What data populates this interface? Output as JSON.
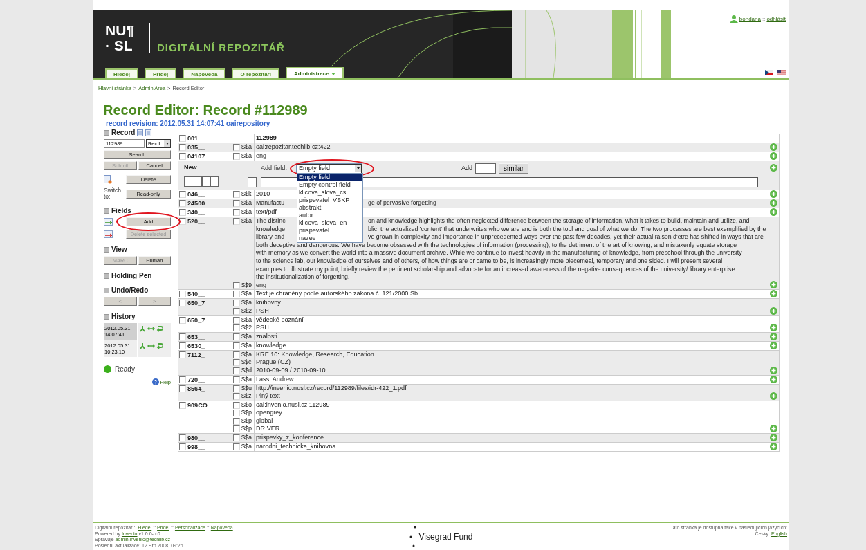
{
  "header": {
    "logo_lines": [
      "NU¶",
      "· SL"
    ],
    "site_name": "DIGITÁLNÍ REPOZITÁŘ",
    "tabs": [
      {
        "label": "Hledej",
        "selected": false,
        "caret": false
      },
      {
        "label": "Přidej",
        "selected": false,
        "caret": false
      },
      {
        "label": "Nápověda",
        "selected": false,
        "caret": false
      },
      {
        "label": "O repozitáři",
        "selected": false,
        "caret": false
      },
      {
        "label": "Administrace",
        "selected": true,
        "caret": true
      }
    ],
    "user": {
      "name": "bohdana",
      "separator": "::",
      "logout": "odhlásit"
    }
  },
  "breadcrumb": {
    "items": [
      "Hlavní stránka",
      "Admin Area",
      "Record Editor"
    ],
    "separator": ">"
  },
  "title": "Record Editor: Record #112989",
  "revision": "record revision: 2012.05.31 14:07:41 oairepository",
  "sidebar": {
    "record": {
      "title": "Record",
      "record_id": "112989",
      "type_select": "Rec I",
      "search": {
        "label": "Search",
        "disabled": false
      },
      "submit": {
        "label": "Submit",
        "disabled": true
      },
      "cancel": {
        "label": "Cancel",
        "disabled": false
      },
      "delete": {
        "label": "Delete",
        "disabled": false
      },
      "switch_label": "Switch to:",
      "read_only": {
        "label": "Read-only",
        "disabled": false
      }
    },
    "fields": {
      "title": "Fields",
      "add": {
        "label": "Add",
        "disabled": false
      },
      "delete_selected": {
        "label": "Delete selected",
        "disabled": true
      }
    },
    "view": {
      "title": "View",
      "buttons": [
        {
          "label": "MARC",
          "disabled": true
        },
        {
          "label": "Human",
          "disabled": false
        }
      ]
    },
    "holding_pen": {
      "title": "Holding Pen"
    },
    "undo_redo": {
      "title": "Undo/Redo",
      "buttons": [
        {
          "label": "<",
          "disabled": true
        },
        {
          "label": ">",
          "disabled": true
        }
      ]
    },
    "history": {
      "title": "History",
      "entries": [
        {
          "date": "2012.05.31",
          "time": "14:07:41",
          "selected": true
        },
        {
          "date": "2012.05.31",
          "time": "10:23:10",
          "selected": false
        }
      ]
    },
    "status": "Ready",
    "help": "Help"
  },
  "fields": [
    {
      "kind": "control",
      "tag": "001",
      "checked": false,
      "value": "112989"
    },
    {
      "kind": "data",
      "tag": "035__",
      "checked": false,
      "subfields": [
        {
          "code": "$$a",
          "checked": false,
          "value": "oai:repozitar.techlib.cz:422"
        }
      ]
    },
    {
      "kind": "data",
      "tag": "04107",
      "checked": false,
      "subfields": [
        {
          "code": "$$a",
          "checked": false,
          "value": "eng"
        }
      ]
    },
    {
      "kind": "new",
      "label": "New",
      "add_field_label": "Add field:",
      "select": {
        "value": "Empty field",
        "expanded": true,
        "options": [
          {
            "label": "Empty field",
            "selected": true
          },
          {
            "label": "Empty control field",
            "selected": false
          },
          {
            "label": "klicova_slova_cs",
            "selected": false
          },
          {
            "label": "prispevatel_VSKP",
            "selected": false
          },
          {
            "label": "abstrakt",
            "selected": false
          },
          {
            "label": "autor",
            "selected": false
          },
          {
            "label": "klicova_slova_en",
            "selected": false
          },
          {
            "label": "prispevatel",
            "selected": false
          },
          {
            "label": "nazev",
            "selected": false
          }
        ]
      },
      "add_label": "Add",
      "similar": "similar"
    },
    {
      "kind": "data",
      "tag": "046__",
      "checked": false,
      "subfields": [
        {
          "code": "$$k",
          "checked": false,
          "value": "2010"
        }
      ]
    },
    {
      "kind": "data",
      "tag": "24500",
      "checked": false,
      "subfields": [
        {
          "code": "$$a",
          "checked": false,
          "lines": [
            {
              "left": "Manufactu",
              "right": "ge of pervasive forgetting"
            }
          ]
        }
      ]
    },
    {
      "kind": "data",
      "tag": "340__",
      "checked": false,
      "subfields": [
        {
          "code": "$$a",
          "checked": false,
          "value": "text/pdf"
        }
      ]
    },
    {
      "kind": "data",
      "tag": "520__",
      "checked": false,
      "subfields": [
        {
          "code": "$$a",
          "checked": false,
          "lines": [
            {
              "left": "The distinc",
              "right": "on and knowledge highlights the often neglected difference between the storage of information, what it takes to build, maintain and utilize, and"
            },
            {
              "left": "knowledge",
              "right": "blic, the actualized 'content' that underwrites who we are and is both the tool and goal of what we do. The two processes are best exemplified by the"
            },
            {
              "left": "library and",
              "right": "ve grown in complexity and importance in unprecedented ways over the past few decades, yet their actual raison d'etre has shifted in ways that are"
            },
            {
              "left": "both deceptive and dangerous. We have become obsessed with the technologies of information (processing), to the detriment of the art of knowing, and mistakenly equate storage"
            },
            {
              "left": "with memory as we convert the world into a massive document archive. While we continue to invest heavily in the manufacturing of knowledge, from preschool through the university"
            },
            {
              "left": "to the science lab, our knowledge of ourselves and of others, of how things are or came to be, is increasingly more piecemeal, temporary and one sided. I will present several"
            },
            {
              "left": "examples to illustrate my point, briefly review the pertinent scholarship and advocate for an increased awareness of the negative consequences of the university/ library enterprise:"
            },
            {
              "left": "the institutionalization of forgetting."
            }
          ]
        },
        {
          "code": "$$9",
          "checked": false,
          "value": "eng"
        }
      ]
    },
    {
      "kind": "data",
      "tag": "540__",
      "checked": false,
      "subfields": [
        {
          "code": "$$a",
          "checked": false,
          "value": "Text je chráněný podle autorského zákona č. 121/2000 Sb."
        }
      ]
    },
    {
      "kind": "data",
      "tag": "650_7",
      "checked": false,
      "subfields": [
        {
          "code": "$$a",
          "checked": false,
          "value": "knihovny"
        },
        {
          "code": "$$2",
          "checked": false,
          "value": "PSH"
        }
      ]
    },
    {
      "kind": "data",
      "tag": "650_7",
      "checked": false,
      "subfields": [
        {
          "code": "$$a",
          "checked": false,
          "value": "vědecké poznání"
        },
        {
          "code": "$$2",
          "checked": false,
          "value": "PSH"
        }
      ]
    },
    {
      "kind": "data",
      "tag": "653__",
      "checked": false,
      "subfields": [
        {
          "code": "$$a",
          "checked": false,
          "value": "znalosti"
        }
      ]
    },
    {
      "kind": "data",
      "tag": "6530_",
      "checked": false,
      "subfields": [
        {
          "code": "$$a",
          "checked": false,
          "value": "knowledge"
        }
      ]
    },
    {
      "kind": "data",
      "tag": "7112_",
      "checked": false,
      "subfields": [
        {
          "code": "$$a",
          "checked": false,
          "value": "KRE 10: Knowledge, Research, Education"
        },
        {
          "code": "$$c",
          "checked": false,
          "value": "Prague (CZ)"
        },
        {
          "code": "$$d",
          "checked": false,
          "value": "2010-09-09 / 2010-09-10"
        }
      ]
    },
    {
      "kind": "data",
      "tag": "720__",
      "checked": false,
      "subfields": [
        {
          "code": "$$a",
          "checked": false,
          "value": "Lass, Andrew"
        }
      ]
    },
    {
      "kind": "data",
      "tag": "8564_",
      "checked": false,
      "subfields": [
        {
          "code": "$$u",
          "checked": false,
          "value": "http://invenio.nusl.cz/record/112989/files/idr-422_1.pdf"
        },
        {
          "code": "$$z",
          "checked": false,
          "value": "Plný text"
        }
      ]
    },
    {
      "kind": "data",
      "tag": "909CO",
      "checked": false,
      "subfields": [
        {
          "code": "$$o",
          "checked": false,
          "value": "oai:invenio.nusl.cz:112989"
        },
        {
          "code": "$$p",
          "checked": false,
          "value": "opengrey"
        },
        {
          "code": "$$p",
          "checked": false,
          "value": "global"
        },
        {
          "code": "$$p",
          "checked": false,
          "value": "DRIVER"
        }
      ]
    },
    {
      "kind": "data",
      "tag": "980__",
      "checked": false,
      "subfields": [
        {
          "code": "$$a",
          "checked": false,
          "value": "prispevky_z_konference"
        }
      ]
    },
    {
      "kind": "data",
      "tag": "998__",
      "checked": false,
      "subfields": [
        {
          "code": "$$a",
          "checked": false,
          "value": "narodni_technicka_knihovna"
        }
      ]
    }
  ],
  "footer": {
    "site": "Digitální repozitář",
    "separator": "::",
    "links": [
      "Hledej",
      "Přidej",
      "Personalizace",
      "Nápověda"
    ],
    "powered": {
      "before": "Powered by",
      "link": "Invenio",
      "after": "v1.0.0-rc0"
    },
    "maintainer": {
      "before": "Spravuje",
      "link": "admin.invenio@techlib.cz"
    },
    "updated": "Poslední aktualizace: 12 Srp 2008, 09:26",
    "partner": "Visegrad Fund",
    "languages_note": "Tato stránka je dostupná také v následujících jazycích:",
    "languages": [
      {
        "label": "Česky",
        "link": false
      },
      {
        "label": "English",
        "link": true
      }
    ]
  }
}
